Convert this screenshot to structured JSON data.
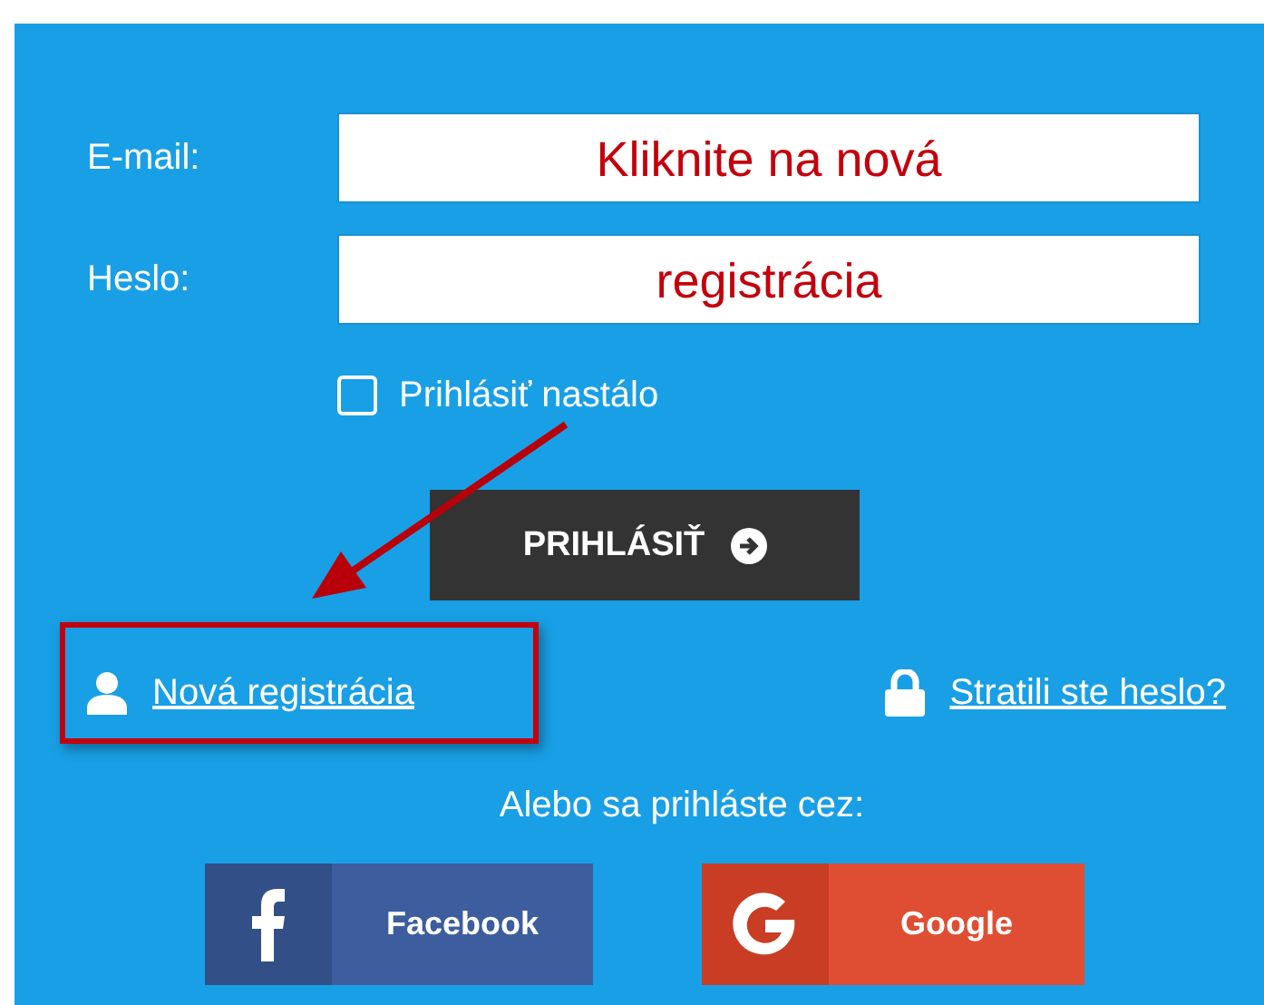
{
  "form": {
    "fields": [
      {
        "label": "E-mail:"
      },
      {
        "label": "Heslo:"
      }
    ],
    "remember": {
      "label": "Prihlásiť nastálo",
      "checked": false
    },
    "submit": {
      "label": "PRIHLÁSIŤ"
    },
    "links": [
      {
        "kind": "person",
        "label": "Nová registrácia"
      },
      {
        "kind": "lock",
        "label": "Stratili ste heslo?"
      }
    ],
    "social_prompt": "Alebo sa prihláste cez:",
    "social": [
      {
        "kind": "facebook",
        "label": "Facebook"
      },
      {
        "kind": "google",
        "label": "Google"
      }
    ]
  },
  "annotation": {
    "lines": [
      "Kliknite na nová",
      "registrácia"
    ]
  }
}
